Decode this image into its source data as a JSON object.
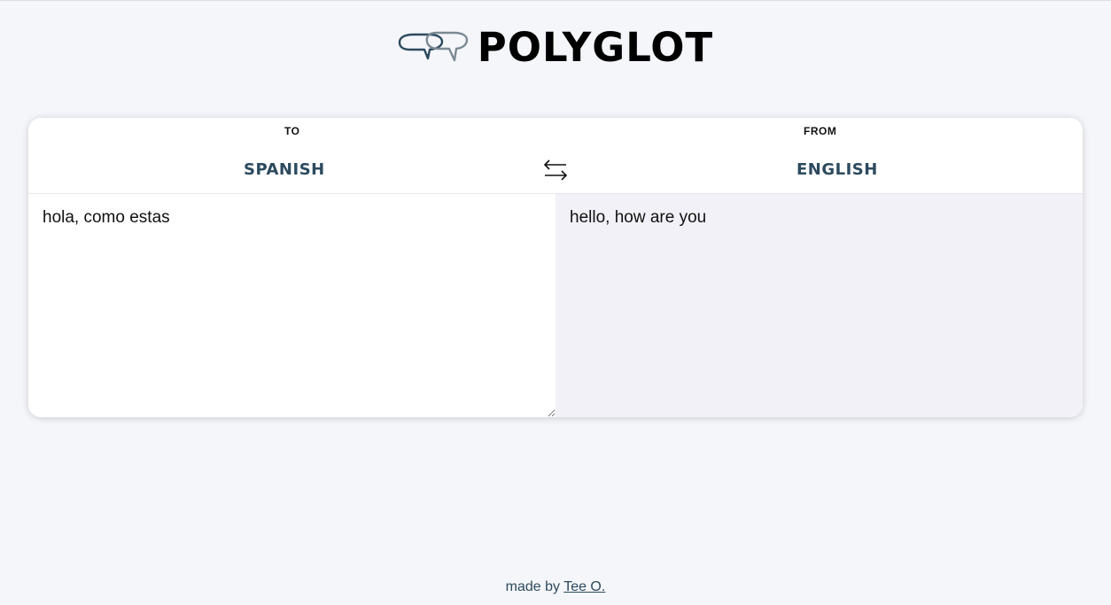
{
  "app": {
    "title": "POLYGLOT"
  },
  "translator": {
    "source_direction_label": "TO",
    "target_direction_label": "FROM",
    "source_language": "SPANISH",
    "target_language": "ENGLISH",
    "input_text": "hola, como estas",
    "output_text": "hello, how are you"
  },
  "footer": {
    "prefix": "made by",
    "author_link": "Tee O."
  },
  "colors": {
    "background": "#f5f6fa",
    "accent": "#2c4a5e",
    "output_pane": "#f1f1f7",
    "card": "#ffffff"
  },
  "icons": {
    "logo": "speech-bubbles-icon",
    "swap": "swap-arrows-icon"
  }
}
